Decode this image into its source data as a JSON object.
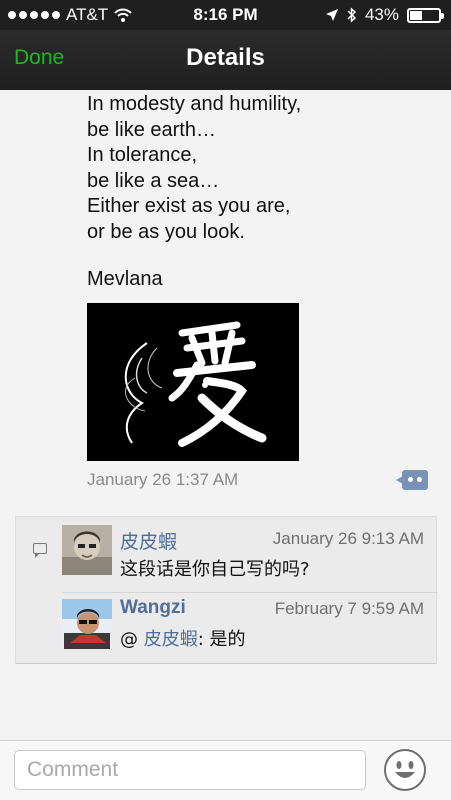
{
  "status_bar": {
    "carrier": "AT&T",
    "time": "8:16 PM",
    "battery": "43%",
    "battery_level": 0.43
  },
  "nav": {
    "done_label": "Done",
    "title": "Details"
  },
  "post": {
    "text": "In modesty and humility,\nbe like earth…\nIn tolerance,\nbe like a sea…\nEither exist as you are,\nor be as you look.",
    "author_line": "Mevlana",
    "timestamp": "January 26 1:37 AM"
  },
  "comments": [
    {
      "name": "皮皮蝦",
      "time": "January 26 9:13 AM",
      "text": "这段话是你自己写的吗?"
    },
    {
      "name": "Wangzi",
      "time": "February 7 9:59 AM",
      "mention_prefix": "@ ",
      "mention": "皮皮蝦",
      "text": ": 是的"
    }
  ],
  "input": {
    "placeholder": "Comment"
  },
  "icons": [
    "signal-icon",
    "wifi-icon",
    "location-arrow-icon",
    "bluetooth-icon",
    "battery-icon",
    "comment-toggle-icon",
    "comment-bubble-icon",
    "emoji-icon"
  ],
  "colors": {
    "done_green": "#1fb71f",
    "name_blue": "#4f6e99",
    "bar_dark": "#1f1f1f"
  }
}
